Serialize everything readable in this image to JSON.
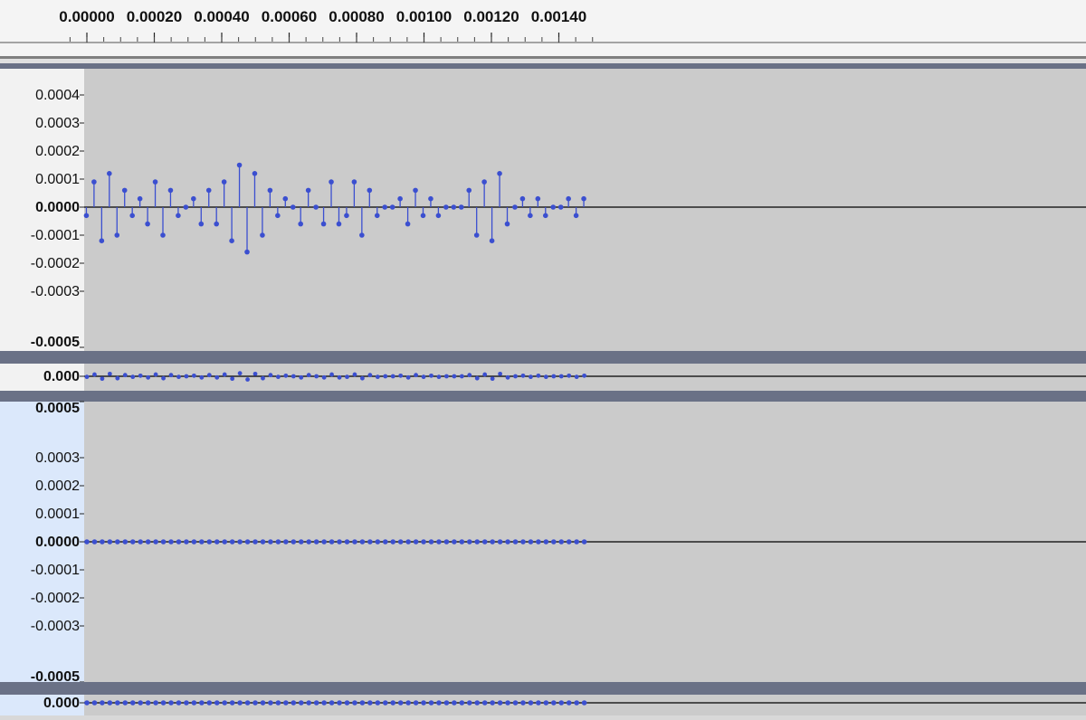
{
  "timeline": {
    "ticks": [
      "0.00000",
      "0.00020",
      "0.00040",
      "0.00060",
      "0.00080",
      "0.00100",
      "0.00120",
      "0.00140"
    ]
  },
  "colors": {
    "sample": "#3b4fd0",
    "plot_bg": "#cbcbcb",
    "ruler_bg": "#f4f4f4",
    "selected_scale_bg": "#dbe8fb",
    "separator": "#6a7186",
    "baseline": "#000000"
  },
  "chart_data": [
    {
      "type": "stem",
      "name": "track-1-top",
      "x_unit": "seconds",
      "x_start": -1.5e-06,
      "x_step": 2.27e-05,
      "ylim": [
        -0.0005,
        0.0005
      ],
      "y_ticks": [
        "0.0004",
        "0.0003",
        "0.0002",
        "0.0001",
        "0.0000",
        "-0.0001",
        "-0.0002",
        "-0.0003",
        "-0.0005"
      ],
      "y_values": [
        -3e-05,
        9e-05,
        -0.00012,
        0.00012,
        -0.0001,
        6e-05,
        -3e-05,
        3e-05,
        -6e-05,
        9e-05,
        -0.0001,
        6e-05,
        -3e-05,
        0.0,
        3e-05,
        -6e-05,
        6e-05,
        -6e-05,
        9e-05,
        -0.00012,
        0.00015,
        -0.00016,
        0.00012,
        -0.0001,
        6e-05,
        -3e-05,
        3e-05,
        0.0,
        -6e-05,
        6e-05,
        0.0,
        -6e-05,
        9e-05,
        -6e-05,
        -3e-05,
        9e-05,
        -0.0001,
        6e-05,
        -3e-05,
        0.0,
        0.0,
        3e-05,
        -6e-05,
        6e-05,
        -3e-05,
        3e-05,
        -3e-05,
        0.0,
        0.0,
        0.0,
        6e-05,
        -0.0001,
        9e-05,
        -0.00012,
        0.00012,
        -6e-05,
        0.0,
        3e-05,
        -3e-05,
        3e-05,
        -3e-05,
        0.0,
        0.0,
        3e-05,
        -3e-05,
        3e-05
      ]
    },
    {
      "type": "stem",
      "name": "track-1-bottom",
      "x_unit": "seconds",
      "x_start": 0.0,
      "x_step": 2.27e-05,
      "y_ticks": [
        "0.000"
      ],
      "y_values": [
        0.0,
        0.0,
        0.0,
        0.0,
        0.0,
        0.0,
        0.0,
        0.0,
        0.0,
        0.0,
        0.0,
        0.0,
        0.0,
        0.0,
        0.0,
        0.0,
        0.0,
        0.0,
        0.0,
        0.0,
        0.0,
        0.0,
        0.0,
        0.0,
        0.0,
        0.0,
        0.0,
        0.0,
        0.0,
        0.0,
        0.0,
        0.0,
        0.0,
        0.0,
        0.0,
        0.0,
        0.0,
        0.0,
        0.0,
        0.0,
        0.0,
        0.0,
        0.0,
        0.0,
        0.0,
        0.0,
        0.0,
        0.0,
        0.0,
        0.0,
        0.0,
        0.0,
        0.0,
        0.0,
        0.0,
        0.0,
        0.0,
        0.0,
        0.0,
        0.0,
        0.0,
        0.0,
        0.0,
        0.0,
        0.0,
        0.0
      ]
    },
    {
      "type": "stem",
      "name": "track-2-top",
      "x_unit": "seconds",
      "x_start": 0.0,
      "x_step": 2.27e-05,
      "ylim": [
        -0.0005,
        0.0005
      ],
      "y_ticks": [
        "0.0005",
        "0.0003",
        "0.0002",
        "0.0001",
        "0.0000",
        "-0.0001",
        "-0.0002",
        "-0.0003",
        "-0.0005"
      ],
      "y_values": [
        0.0,
        0.0,
        0.0,
        0.0,
        0.0,
        0.0,
        0.0,
        0.0,
        0.0,
        0.0,
        0.0,
        0.0,
        0.0,
        0.0,
        0.0,
        0.0,
        0.0,
        0.0,
        0.0,
        0.0,
        0.0,
        0.0,
        0.0,
        0.0,
        0.0,
        0.0,
        0.0,
        0.0,
        0.0,
        0.0,
        0.0,
        0.0,
        0.0,
        0.0,
        0.0,
        0.0,
        0.0,
        0.0,
        0.0,
        0.0,
        0.0,
        0.0,
        0.0,
        0.0,
        0.0,
        0.0,
        0.0,
        0.0,
        0.0,
        0.0,
        0.0,
        0.0,
        0.0,
        0.0,
        0.0,
        0.0,
        0.0,
        0.0,
        0.0,
        0.0,
        0.0,
        0.0,
        0.0,
        0.0,
        0.0,
        0.0
      ]
    },
    {
      "type": "stem",
      "name": "track-2-bottom",
      "x_unit": "seconds",
      "x_start": 0.0,
      "x_step": 2.27e-05,
      "y_ticks": [
        "0.000"
      ],
      "y_values": [
        0.0,
        0.0,
        0.0,
        0.0,
        0.0,
        0.0,
        0.0,
        0.0,
        0.0,
        0.0,
        0.0,
        0.0,
        0.0,
        0.0,
        0.0,
        0.0,
        0.0,
        0.0,
        0.0,
        0.0,
        0.0,
        0.0,
        0.0,
        0.0,
        0.0,
        0.0,
        0.0,
        0.0,
        0.0,
        0.0,
        0.0,
        0.0,
        0.0,
        0.0,
        0.0,
        0.0,
        0.0,
        0.0,
        0.0,
        0.0,
        0.0,
        0.0,
        0.0,
        0.0,
        0.0,
        0.0,
        0.0,
        0.0,
        0.0,
        0.0,
        0.0,
        0.0,
        0.0,
        0.0,
        0.0,
        0.0,
        0.0,
        0.0,
        0.0,
        0.0,
        0.0,
        0.0,
        0.0,
        0.0,
        0.0,
        0.0
      ]
    }
  ]
}
